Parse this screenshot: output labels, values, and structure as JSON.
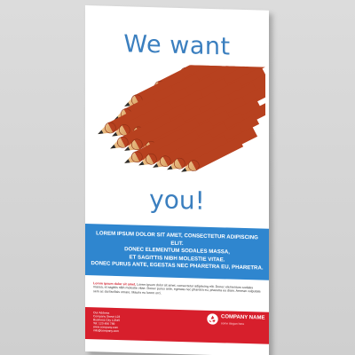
{
  "poster": {
    "headline_top": "We want",
    "headline_bottom": "you!",
    "blue_lines": [
      "LOREM IPSUM DOLOR SIT AMET, CONSECTETUR ADIPISCING ELIT.",
      "DONEC ELEMENTUM SODALES MASSA,",
      "ET SAGITTIS NIBH MOLESTIE VITAE.",
      "DONEC PURUS ANTE, EGESTAS NEC PHARETRA EU, PHARETRA."
    ],
    "body_text": "Lorem ipsum dolor sit amet, consectetur adipiscing elit. Donec elementum sodales massa, et sagittis nibh molestie vitae. Donec purus ante, egestas nec pharetra eu, pharetra eu diam. Aenean vulputate sem ac dui facilisis ornare. Mauris eu lorem orci.",
    "body_highlight": "Lorem ipsum dolor sit amet,",
    "contact_lines": [
      "Our Address",
      "Company Street 123",
      "Business City 12345",
      "Tel: 123 456 789",
      "www.company.com",
      "info@company.com"
    ],
    "company_name": "COMPANY NAME",
    "company_tagline": "some slogan here",
    "colors": {
      "headline": "#3b7fbf",
      "blue_band": "#2f86cf",
      "red_band": "#d71f2c"
    },
    "icons": [
      "recycle-logo-icon"
    ]
  }
}
